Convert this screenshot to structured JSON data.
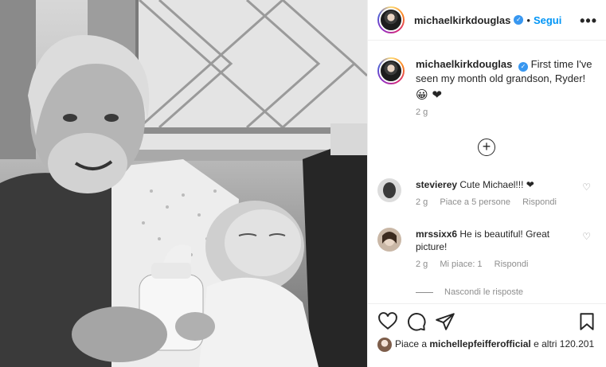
{
  "post": {
    "username": "michaelkirkdouglas",
    "follow_label": "Segui",
    "caption": "First time I've seen my month old grandson, Ryder!",
    "caption_emojis": "😀 ❤",
    "time": "2 g",
    "more_label": "•••"
  },
  "comments": [
    {
      "username": "stevierey",
      "text": "Cute Michael!!! ❤",
      "time": "2 g",
      "likes": "Piace a 5 persone",
      "reply": "Rispondi"
    },
    {
      "username": "mrssixx6",
      "text": "He is beautiful! Great picture!",
      "time": "2 g",
      "likes": "Mi piace: 1",
      "reply": "Rispondi"
    }
  ],
  "hide_replies": "Nascondi le risposte",
  "likes_summary": {
    "prefix": "Piace a",
    "user": "michellepfeifferofficial",
    "suffix": "e altri 120.201"
  },
  "icons": {
    "verified": "verified-badge",
    "more": "more-icon",
    "add": "plus-circle-icon",
    "like": "heart-outline-icon",
    "comment": "comment-icon",
    "share": "send-icon",
    "save": "bookmark-icon"
  },
  "colors": {
    "accent": "#0095f6",
    "heart": "#ed4956",
    "muted": "#8e8e8e"
  }
}
